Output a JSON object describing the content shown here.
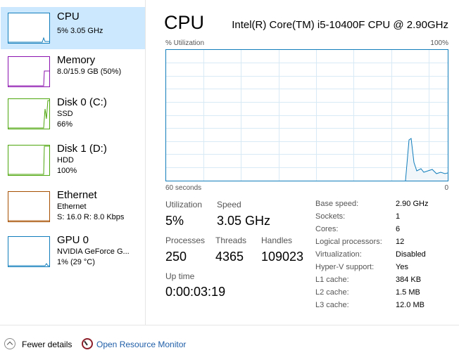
{
  "sidebar": {
    "items": [
      {
        "title": "CPU",
        "line1": "5% 3.05 GHz",
        "color": "#117dbb",
        "selected": true
      },
      {
        "title": "Memory",
        "line1": "8.0/15.9 GB (50%)",
        "color": "#8b12ae"
      },
      {
        "title": "Disk 0 (C:)",
        "line1": "SSD",
        "line2": "66%",
        "color": "#4da60c"
      },
      {
        "title": "Disk 1 (D:)",
        "line1": "HDD",
        "line2": "100%",
        "color": "#4da60c"
      },
      {
        "title": "Ethernet",
        "line1": "Ethernet",
        "line2": "S: 16.0  R: 8.0 Kbps",
        "color": "#a74f01"
      },
      {
        "title": "GPU 0",
        "line1": "NVIDIA GeForce G...",
        "line2": "1% (29 °C)",
        "color": "#117dbb"
      }
    ]
  },
  "main": {
    "title": "CPU",
    "model": "Intel(R) Core(TM) i5-10400F CPU @ 2.90GHz",
    "graph": {
      "top_left": "% Utilization",
      "top_right": "100%",
      "bottom_left": "60 seconds",
      "bottom_right": "0",
      "color": "#117dbb"
    },
    "stats": {
      "utilization_label": "Utilization",
      "utilization_value": "5%",
      "speed_label": "Speed",
      "speed_value": "3.05 GHz",
      "processes_label": "Processes",
      "processes_value": "250",
      "threads_label": "Threads",
      "threads_value": "4365",
      "handles_label": "Handles",
      "handles_value": "109023",
      "uptime_label": "Up time",
      "uptime_value": "0:00:03:19"
    },
    "specs": [
      {
        "label": "Base speed:",
        "value": "2.90 GHz"
      },
      {
        "label": "Sockets:",
        "value": "1"
      },
      {
        "label": "Cores:",
        "value": "6"
      },
      {
        "label": "Logical processors:",
        "value": "12"
      },
      {
        "label": "Virtualization:",
        "value": "Disabled"
      },
      {
        "label": "Hyper-V support:",
        "value": "Yes"
      },
      {
        "label": "L1 cache:",
        "value": "384 KB"
      },
      {
        "label": "L2 cache:",
        "value": "1.5 MB"
      },
      {
        "label": "L3 cache:",
        "value": "12.0 MB"
      }
    ]
  },
  "footer": {
    "fewer_details": "Fewer details",
    "resource_monitor": "Open Resource Monitor"
  }
}
